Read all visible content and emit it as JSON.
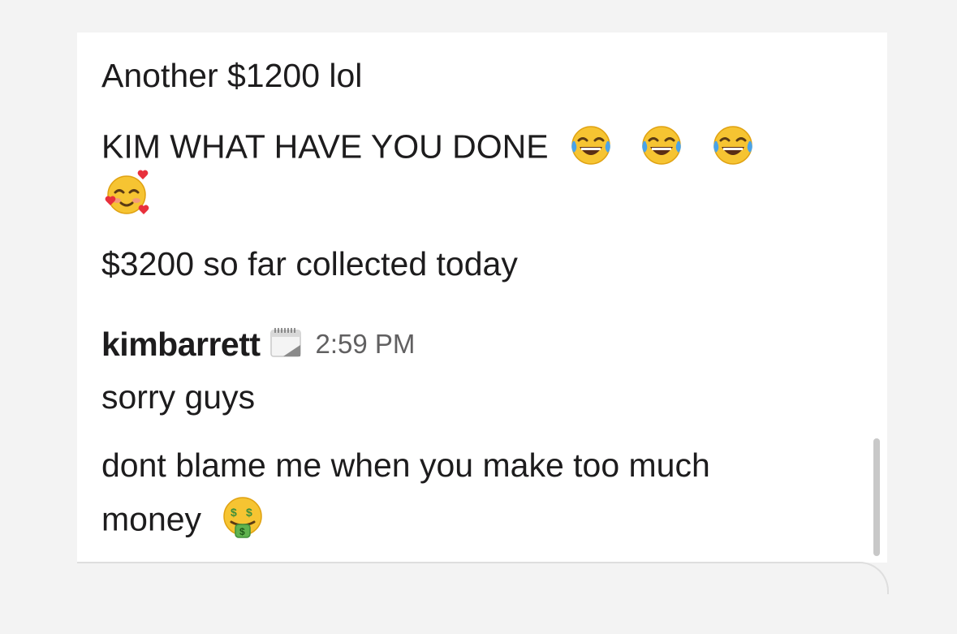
{
  "messages": {
    "earlier": [
      {
        "text": "Another $1200 lol"
      },
      {
        "text": "KIM WHAT HAVE YOU DONE",
        "emojis": [
          "tears-of-joy-icon",
          "tears-of-joy-icon",
          "tears-of-joy-icon",
          "smiling-face-with-hearts-icon"
        ]
      },
      {
        "text": "$3200 so far collected today"
      }
    ],
    "group": {
      "sender": "kimbarrett",
      "status_icon": "calendar-icon",
      "timestamp": "2:59 PM",
      "lines": [
        {
          "text": "sorry guys"
        },
        {
          "text": "dont blame me when you make too much"
        },
        {
          "text": "money",
          "emojis": [
            "money-mouth-face-icon"
          ]
        }
      ]
    }
  },
  "colors": {
    "text": "#1d1c1d",
    "timestamp": "#616061",
    "background": "#ffffff"
  }
}
